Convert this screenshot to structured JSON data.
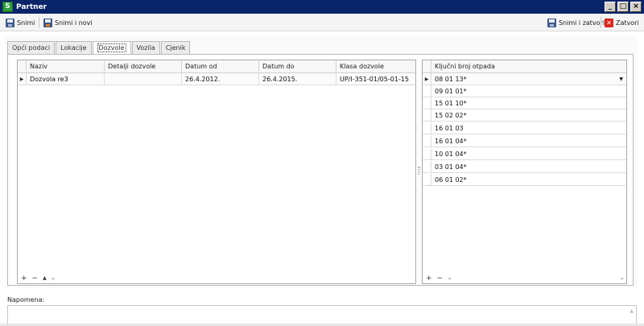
{
  "window": {
    "title": "Partner",
    "app_icon_letter": "S",
    "minimize": "_",
    "maximize": "□",
    "close": "×"
  },
  "toolbar": {
    "save_label": "Snimi",
    "save_new_label": "Snimi i novi",
    "save_close_label": "Snimi i zatvori",
    "close_label": "Zatvori"
  },
  "tabs": [
    {
      "label": "Opći podaci",
      "active": false
    },
    {
      "label": "Lokacije",
      "active": false
    },
    {
      "label": "Dozvole",
      "active": true
    },
    {
      "label": "Vozila",
      "active": false
    },
    {
      "label": "Cjenik",
      "active": false
    }
  ],
  "permits_grid": {
    "columns": [
      "Naziv",
      "Detalji dozvole",
      "Datum od",
      "Datum do",
      "Klasa dozvole"
    ],
    "rows": [
      [
        "Dozvola re3",
        "",
        "26.4.2012.",
        "26.4.2015.",
        "UP/I-351-01/05-01-15"
      ]
    ],
    "footer": {
      "add": "+",
      "remove": "−",
      "up": "▲",
      "left": "◂"
    }
  },
  "waste_grid": {
    "columns": [
      "Ključni broj otpada"
    ],
    "rows": [
      "08 01 13*",
      "09 01 01*",
      "15 01 10*",
      "15 02 02*",
      "16 01 03",
      "16 01 04*",
      "10 01 04*",
      "03 01 04*",
      "06 01 02*"
    ],
    "footer": {
      "add": "+",
      "remove": "−",
      "left": "◂",
      "right": "▸"
    }
  },
  "note": {
    "label": "Napomena:",
    "value": "",
    "scroll_up": "▲"
  },
  "glyphs": {
    "row_pointer": "▶",
    "dropdown": "▼"
  },
  "colors": {
    "titlebar": "#0a246a",
    "close_red": "#d9261c"
  }
}
